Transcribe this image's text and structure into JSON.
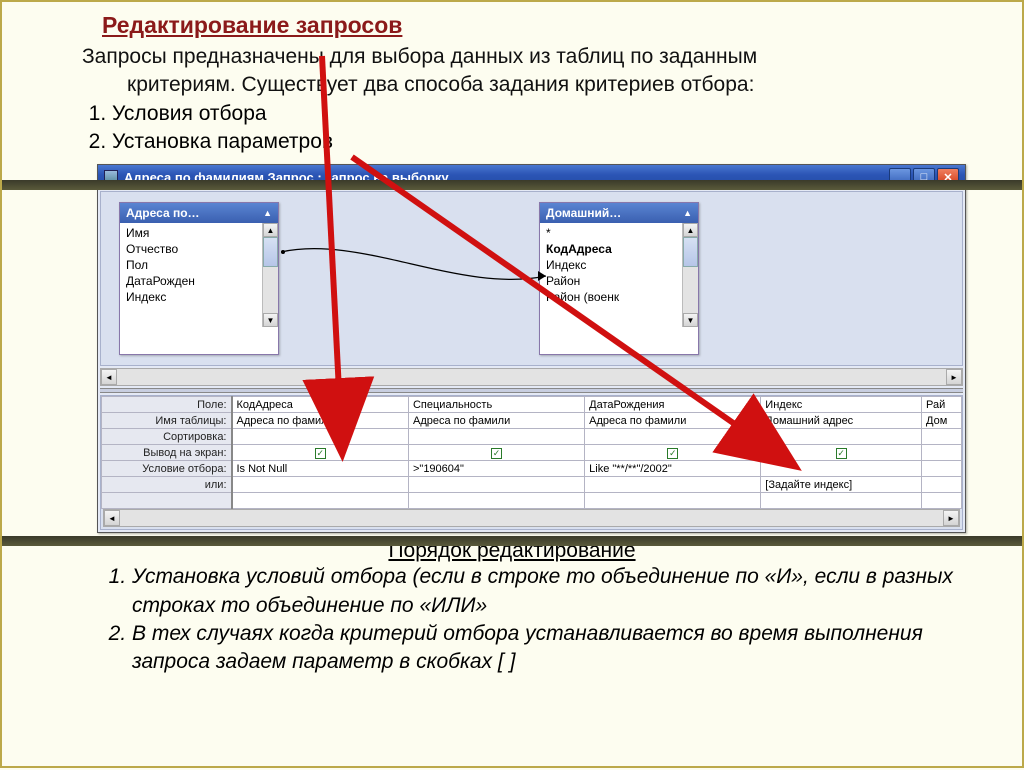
{
  "header": {
    "title": "Редактирование запросов"
  },
  "intro": {
    "para": "Запросы предназначены для выбора данных из таблиц по заданным",
    "para2": "критериям. Существует два способа задания критериев отбора:",
    "items": [
      "Условия отбора",
      "Установка параметров"
    ]
  },
  "window": {
    "title": "Адреса по фамилиям Запрос : запрос на выборку",
    "minimize": "_",
    "maximize": "□",
    "close": "✕"
  },
  "tables": {
    "left": {
      "title": "Адреса по…",
      "fields": [
        "Имя",
        "Отчество",
        "Пол",
        "ДатаРожден",
        "Индекс"
      ]
    },
    "right": {
      "title": "Домашний…",
      "fields": [
        "*",
        "КодАдреса",
        "Индекс",
        "Район",
        "Район (военк"
      ]
    }
  },
  "grid": {
    "labels": {
      "field": "Поле:",
      "table": "Имя таблицы:",
      "sort": "Сортировка:",
      "show": "Вывод на экран:",
      "criteria": "Условие отбора:",
      "or": "или:"
    },
    "cols": [
      {
        "field": "КодАдреса",
        "table": "Адреса по фамили",
        "show": true,
        "criteria": "Is Not Null",
        "or": ""
      },
      {
        "field": "Специальность",
        "table": "Адреса по фамили",
        "show": true,
        "criteria": ">\"190604\"",
        "or": ""
      },
      {
        "field": "ДатаРождения",
        "table": "Адреса по фамили",
        "show": true,
        "criteria": "Like \"**/**\"/2002\"",
        "or": ""
      },
      {
        "field": "Индекс",
        "table": "Домашний адрес",
        "show": true,
        "criteria": "",
        "or": "[Задайте индекс]"
      },
      {
        "field": "Рай",
        "table": "Дом",
        "show": false,
        "criteria": "",
        "or": ""
      }
    ]
  },
  "footer": {
    "heading": "Порядок редактирование",
    "items": [
      " Установка условий отбора (если в строке то объединение по «И», если в разных строках то объединение по «ИЛИ»",
      "В тех случаях когда критерий отбора устанавливается во время выполнения запроса задаем параметр в скобках [ ]"
    ]
  }
}
